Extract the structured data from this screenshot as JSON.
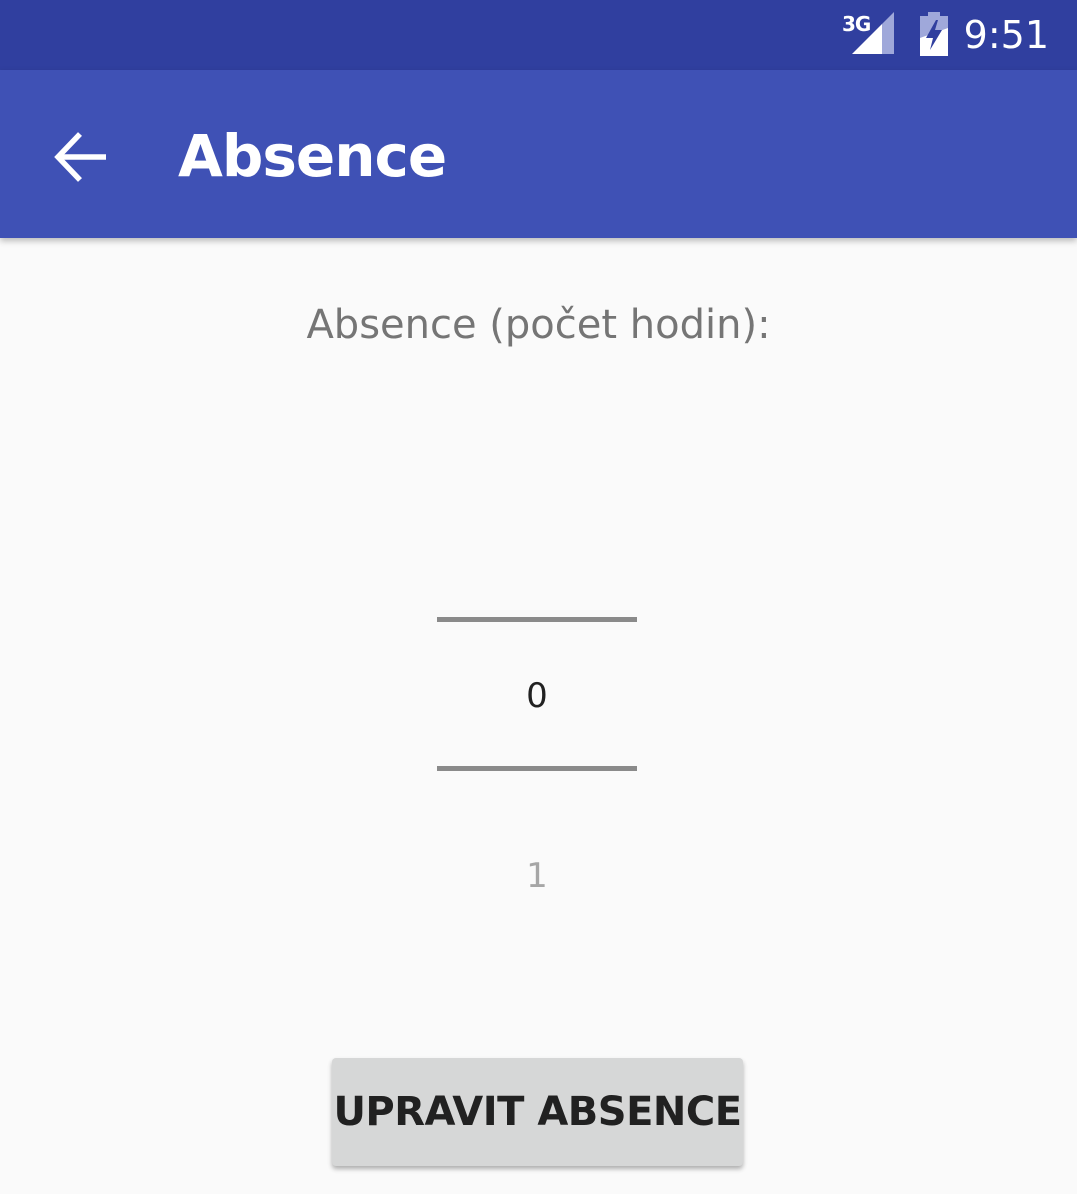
{
  "status_bar": {
    "network_type": "3G",
    "time": "9:51",
    "signal_icon": "cellular-signal-icon",
    "battery_icon": "battery-charging-icon"
  },
  "app_bar": {
    "title": "Absence",
    "back_icon": "arrow-back-icon"
  },
  "form": {
    "label": "Absence (počet hodin):",
    "number_picker": {
      "selected_value": "0",
      "next_value": "1"
    },
    "submit_label": "UPRAVIT ABSENCE"
  },
  "colors": {
    "status_bar": "#303f9f",
    "app_bar": "#3f51b5",
    "background": "#fafafa",
    "button": "#d6d7d7"
  }
}
